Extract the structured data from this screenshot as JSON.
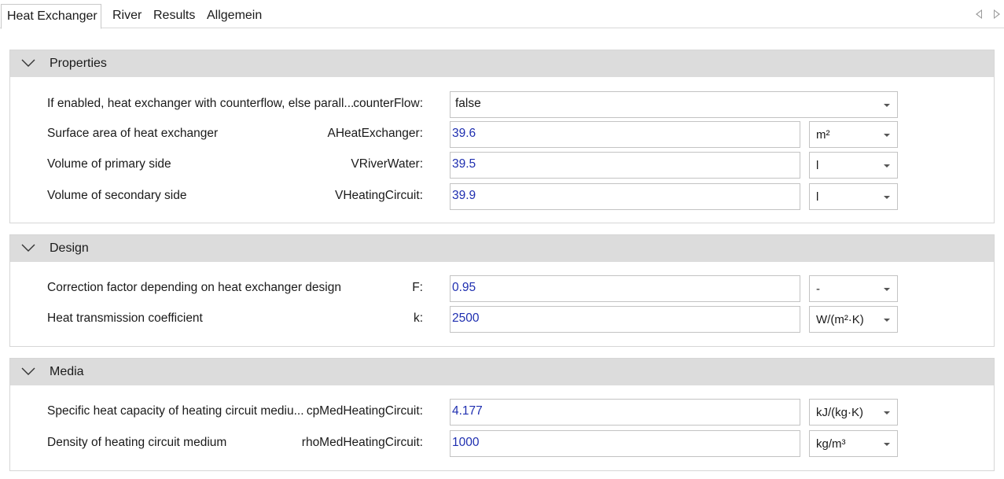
{
  "tabs": [
    {
      "label": "Heat Exchanger",
      "active": true
    },
    {
      "label": "River"
    },
    {
      "label": "Results"
    },
    {
      "label": "Allgemein"
    }
  ],
  "sections": [
    {
      "title": "Properties",
      "rows": [
        {
          "description": "If enabled, heat exchanger with counterflow, else parall...",
          "name": "counterFlow:",
          "value": "false"
        },
        {
          "description": "Surface area of heat exchanger",
          "name": "AHeatExchanger:",
          "value": "39.6",
          "unit": "m²"
        },
        {
          "description": "Volume of primary side",
          "name": "VRiverWater:",
          "value": "39.5",
          "unit": "l"
        },
        {
          "description": "Volume of secondary side",
          "name": "VHeatingCircuit:",
          "value": "39.9",
          "unit": "l"
        }
      ]
    },
    {
      "title": "Design",
      "rows": [
        {
          "description": "Correction factor depending on heat exchanger design",
          "name": "F:",
          "value": "0.95",
          "unit": "-"
        },
        {
          "description": "Heat transmission coefficient",
          "name": "k:",
          "value": "2500",
          "unit": "W/(m²·K)"
        }
      ]
    },
    {
      "title": "Media",
      "rows": [
        {
          "description": "Specific heat capacity of heating circuit mediu...",
          "name": "cpMedHeatingCircuit:",
          "value": "4.177",
          "unit": "kJ/(kg·K)"
        },
        {
          "description": "Density of heating circuit medium",
          "name": "rhoMedHeatingCircuit:",
          "value": "1000",
          "unit": "kg/m³"
        }
      ]
    }
  ],
  "colors": {
    "section_header_bg": "#dcdcdc",
    "value_text": "#1f2fb0",
    "border": "#c3c3c3"
  }
}
